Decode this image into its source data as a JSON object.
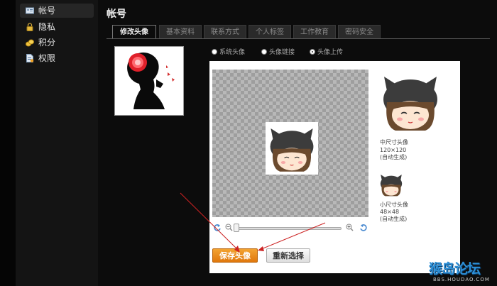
{
  "sidebar": {
    "items": [
      {
        "label": "帐号",
        "icon": "id-card-icon",
        "active": true
      },
      {
        "label": "隐私",
        "icon": "lock-icon",
        "active": false
      },
      {
        "label": "积分",
        "icon": "coins-icon",
        "active": false
      },
      {
        "label": "权限",
        "icon": "permission-doc-icon",
        "active": false
      }
    ]
  },
  "page": {
    "title": "帐号"
  },
  "tabs": [
    {
      "label": "修改头像",
      "active": true
    },
    {
      "label": "基本资料",
      "active": false
    },
    {
      "label": "联系方式",
      "active": false
    },
    {
      "label": "个人标签",
      "active": false
    },
    {
      "label": "工作教育",
      "active": false
    },
    {
      "label": "密码安全",
      "active": false
    }
  ],
  "avatar_source": {
    "options": [
      {
        "label": "系统头像",
        "checked": false
      },
      {
        "label": "头像链接",
        "checked": false
      },
      {
        "label": "头像上传",
        "checked": true
      }
    ]
  },
  "editor": {
    "zoom_level": 0.0,
    "save_label": "保存头像",
    "reselect_label": "重新选择"
  },
  "preview": {
    "medium_title": "中尺寸头像",
    "medium_size": "120×120",
    "medium_note": "(自动生成)",
    "small_title": "小尺寸头像",
    "small_size": "48×48",
    "small_note": "(自动生成)"
  },
  "watermark": {
    "logo_text": "猴岛论坛",
    "url": "BBS.HOUDAO.COM"
  },
  "colors": {
    "background": "#0c0c0c",
    "sidebar": "#141414",
    "save_button": "#e8850f",
    "annotation_arrow": "#cc2222"
  }
}
